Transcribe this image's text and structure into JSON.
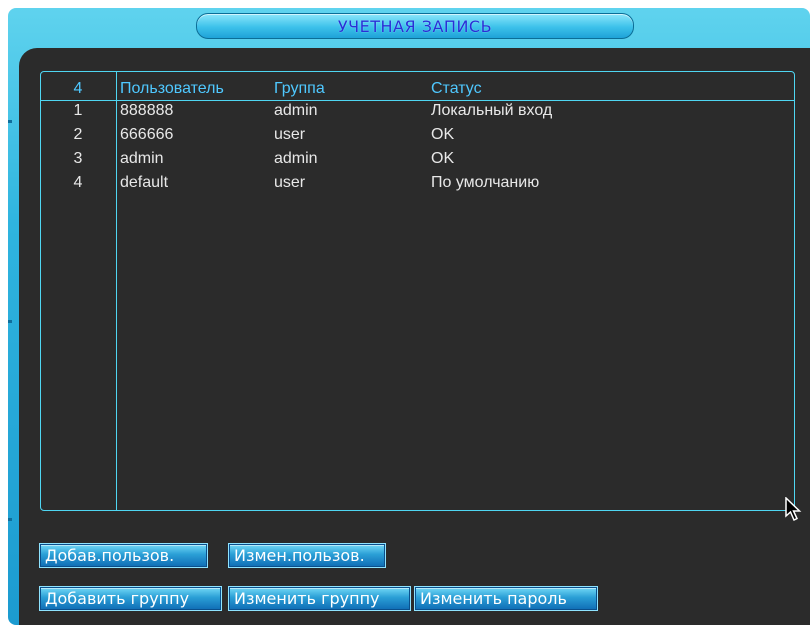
{
  "window": {
    "title": "УЧЕТНАЯ ЗАПИСЬ"
  },
  "table": {
    "headers": {
      "num": "4",
      "user": "Пользователь",
      "group": "Группа",
      "status": "Статус"
    },
    "rows": [
      {
        "num": "1",
        "user": "888888",
        "group": "admin",
        "status": "Локальный вход"
      },
      {
        "num": "2",
        "user": "666666",
        "group": "user",
        "status": "OK"
      },
      {
        "num": "3",
        "user": "admin",
        "group": "admin",
        "status": "OK"
      },
      {
        "num": "4",
        "user": "default",
        "group": "user",
        "status": "По умолчанию"
      }
    ]
  },
  "buttons": {
    "add_user": "Добав.пользов.",
    "edit_user": "Измен.пользов.",
    "add_group": "Добавить группу",
    "edit_group": "Изменить группу",
    "change_password": "Изменить пароль"
  },
  "colors": {
    "frame": "#2fb4df",
    "panel": "#2b2b2b",
    "table_border": "#4fd6f2",
    "header_text": "#4fc8ff",
    "title_text": "#2a2fd6"
  },
  "icons": {
    "pointer": "mouse-pointer-icon"
  }
}
